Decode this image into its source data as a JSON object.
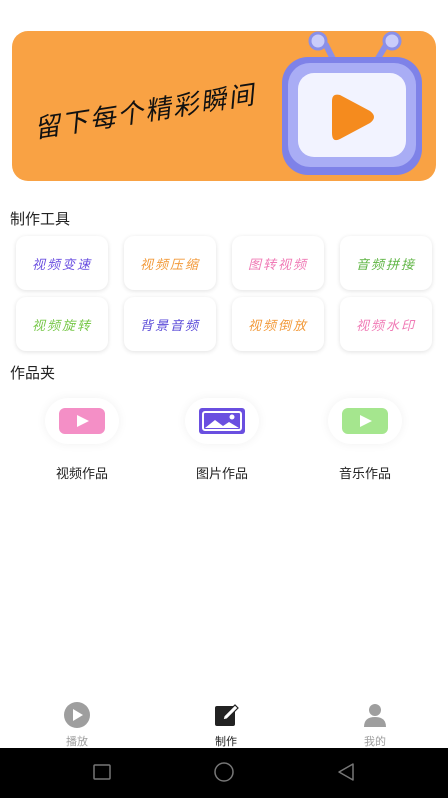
{
  "banner": {
    "text": "留下每个精彩瞬间"
  },
  "sections": {
    "tools_title": "制作工具",
    "works_title": "作品夹"
  },
  "tools": [
    {
      "label": "视频变速",
      "color": "#6A4FE0"
    },
    {
      "label": "视频压缩",
      "color": "#F29A3A"
    },
    {
      "label": "图转视频",
      "color": "#F07BB6"
    },
    {
      "label": "音频拼接",
      "color": "#5FB544"
    },
    {
      "label": "视频旋转",
      "color": "#78C84A"
    },
    {
      "label": "背景音频",
      "color": "#5A4AD8"
    },
    {
      "label": "视频倒放",
      "color": "#F29A3A"
    },
    {
      "label": "视频水印",
      "color": "#F07BB6"
    }
  ],
  "works": [
    {
      "label": "视频作品",
      "icon": "video-icon",
      "color": "#F48FC6"
    },
    {
      "label": "图片作品",
      "icon": "image-icon",
      "color": "#6A4FE0"
    },
    {
      "label": "音乐作品",
      "icon": "music-video-icon",
      "color": "#A5E68E"
    }
  ],
  "nav": {
    "items": [
      {
        "label": "播放",
        "icon": "play-icon",
        "active": false
      },
      {
        "label": "制作",
        "icon": "edit-icon",
        "active": true
      },
      {
        "label": "我的",
        "icon": "user-icon",
        "active": false
      }
    ]
  },
  "system_nav": {
    "icons": [
      "square-icon",
      "circle-icon",
      "back-triangle-icon"
    ]
  }
}
